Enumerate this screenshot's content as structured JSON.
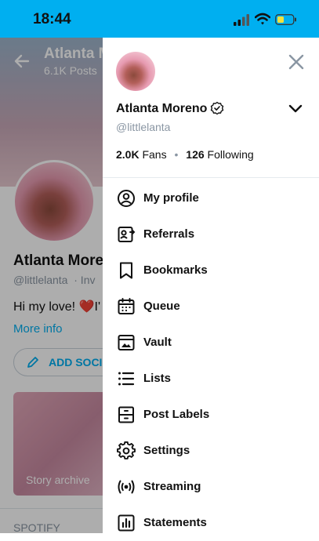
{
  "status_bar": {
    "time": "18:44"
  },
  "background_profile": {
    "header_name": "Atlanta M",
    "header_posts": "6.1K Posts",
    "display_name": "Atlanta More",
    "handle": "@littlelanta",
    "handle_extra": "·  Inv",
    "bio": "Hi my love! ❤️I'",
    "more_info": "More info",
    "add_social": "ADD SOCIA",
    "story_archive": "Story archive",
    "spotify": "SPOTIFY"
  },
  "drawer": {
    "name": "Atlanta Moreno",
    "handle": "@littlelanta",
    "fans_count": "2.0K",
    "fans_label": "Fans",
    "following_count": "126",
    "following_label": "Following",
    "menu": [
      {
        "label": "My profile",
        "icon": "user-circle-icon"
      },
      {
        "label": "Referrals",
        "icon": "referrals-icon"
      },
      {
        "label": "Bookmarks",
        "icon": "bookmark-icon"
      },
      {
        "label": "Queue",
        "icon": "calendar-icon"
      },
      {
        "label": "Vault",
        "icon": "image-icon"
      },
      {
        "label": "Lists",
        "icon": "list-icon"
      },
      {
        "label": "Post Labels",
        "icon": "post-labels-icon"
      },
      {
        "label": "Settings",
        "icon": "gear-icon"
      },
      {
        "label": "Streaming",
        "icon": "broadcast-icon"
      },
      {
        "label": "Statements",
        "icon": "chart-icon"
      }
    ]
  },
  "colors": {
    "accent": "#00aff0",
    "muted": "#8a96a3",
    "text": "#111111"
  }
}
